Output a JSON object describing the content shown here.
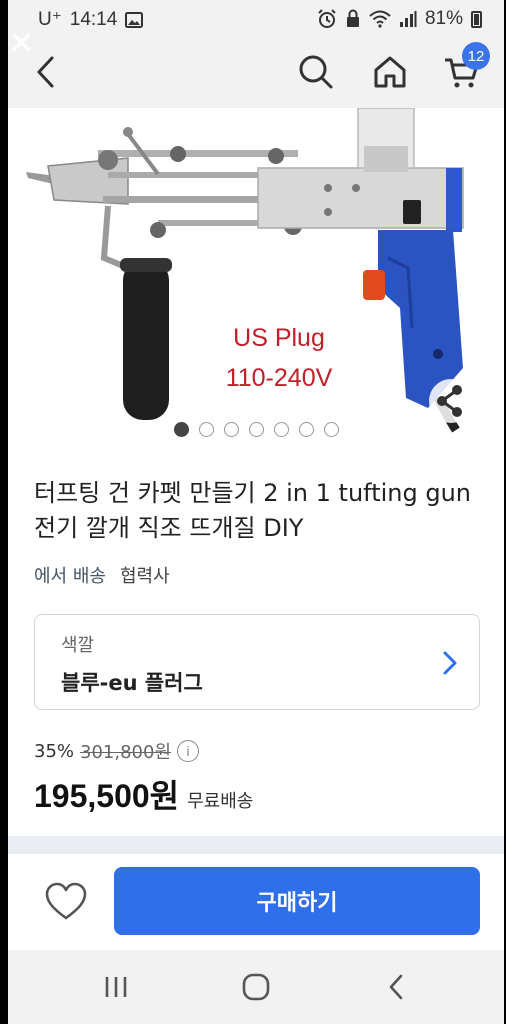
{
  "status_bar": {
    "carrier": "U⁺",
    "time": "14:14",
    "battery": "81%"
  },
  "header": {
    "cart_count": "12"
  },
  "product": {
    "image_caption_1": "US Plug",
    "image_caption_2": "110-240V",
    "image_count": 7,
    "active_image_index": 0,
    "title": "터프팅 건 카펫 만들기 2 in 1 tufting gun 전기 깔개 직조 뜨개질 DIY",
    "ship_from": "에서 배송",
    "partner": "협력사"
  },
  "option": {
    "label": "색깔",
    "value": "블루-eu 플러그"
  },
  "price": {
    "discount": "35%",
    "original": "301,800원",
    "current": "195,500원",
    "shipping": "무료배송"
  },
  "actions": {
    "buy_label": "구매하기"
  },
  "colors": {
    "accent": "#2f6fea",
    "badge": "#3b73e8",
    "caption_red": "#c0202a"
  }
}
